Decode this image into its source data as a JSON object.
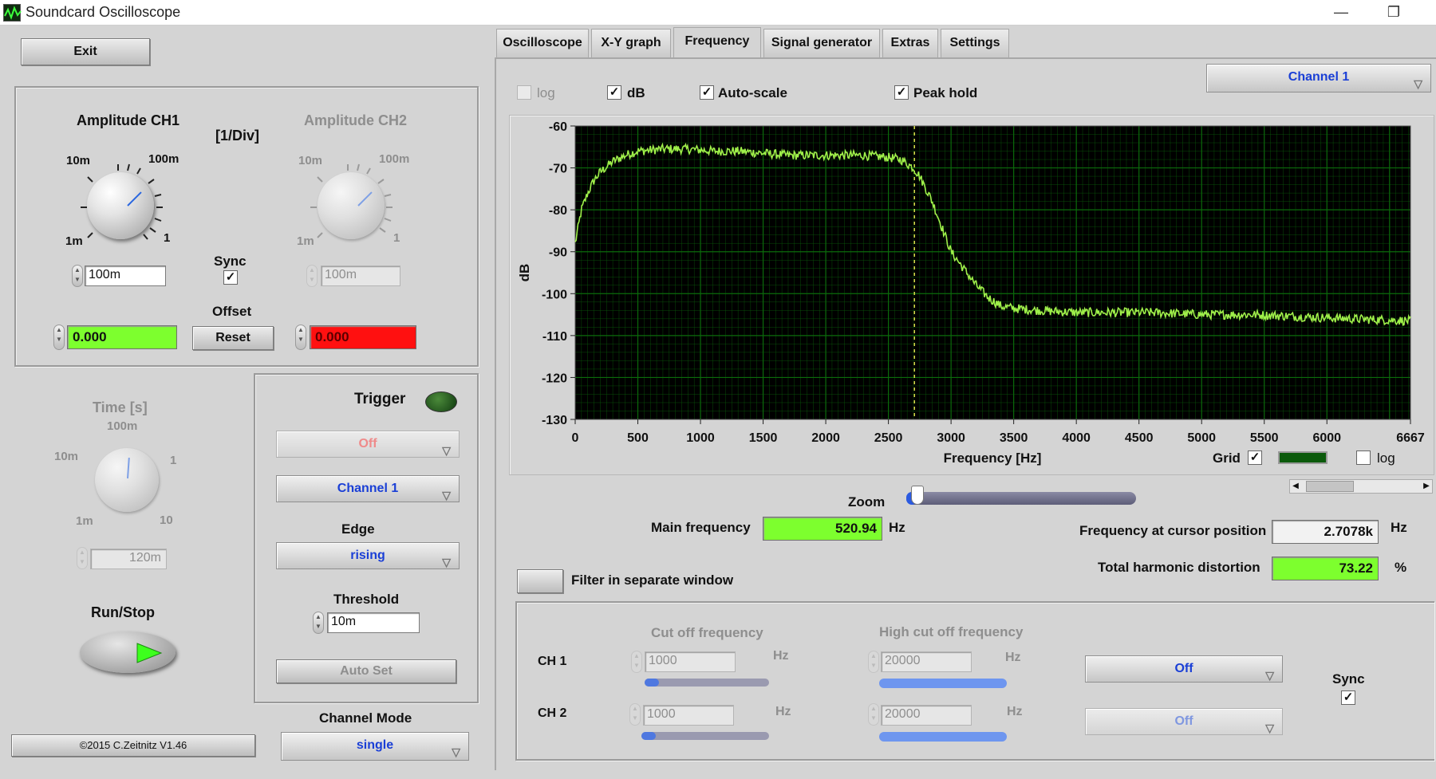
{
  "window": {
    "title": "Soundcard Oscilloscope",
    "minimize_glyph": "—",
    "restore_glyph": "❐"
  },
  "left": {
    "exit_label": "Exit",
    "amp_ch1": {
      "title": "Amplitude CH1",
      "min": "1m",
      "t10m": "10m",
      "t100m": "100m",
      "max": "1",
      "value": "100m"
    },
    "amp_unit": "[1/Div]",
    "amp_ch2": {
      "title": "Amplitude CH2",
      "min": "1m",
      "t10m": "10m",
      "t100m": "100m",
      "max": "1",
      "value": "100m"
    },
    "sync_label": "Sync",
    "offset_label": "Offset",
    "reset_label": "Reset",
    "offset_ch1": "0.000",
    "offset_ch2": "0.000",
    "time": {
      "title": "Time [s]",
      "t1m": "1m",
      "t10m": "10m",
      "t100m": "100m",
      "t1": "1",
      "t10": "10",
      "value": "120m"
    },
    "run_stop_label": "Run/Stop",
    "copyright": "©2015  C.Zeitnitz V1.46",
    "trigger": {
      "title": "Trigger",
      "mode": "Off",
      "channel": "Channel 1",
      "edge_label": "Edge",
      "edge": "rising",
      "threshold_label": "Threshold",
      "threshold": "10m",
      "auto_set_label": "Auto Set"
    },
    "channel_mode_label": "Channel Mode",
    "channel_mode": "single"
  },
  "tabs": [
    {
      "label": "Oscilloscope"
    },
    {
      "label": "X-Y graph"
    },
    {
      "label": "Frequency"
    },
    {
      "label": "Signal generator"
    },
    {
      "label": "Extras"
    },
    {
      "label": "Settings"
    }
  ],
  "frequency": {
    "channel_select": "Channel 1",
    "opt_log": "log",
    "opt_db": "dB",
    "opt_autoscale": "Auto-scale",
    "opt_peakhold": "Peak hold",
    "grid_label": "Grid",
    "xlog_label": "log",
    "zoom_label": "Zoom",
    "main_freq_label": "Main frequency",
    "main_freq_value": "520.94",
    "main_freq_unit": "Hz",
    "cursor_freq_label": "Frequency at cursor position",
    "cursor_freq_value": "2.7078k",
    "cursor_freq_unit": "Hz",
    "thd_label": "Total harmonic distortion",
    "thd_value": "73.22",
    "thd_unit": "%",
    "filter_window_label": "Filter in separate window",
    "filter": {
      "cutoff_label": "Cut off frequency",
      "high_cutoff_label": "High cut off frequency",
      "hz": "Hz",
      "ch1_label": "CH 1",
      "ch2_label": "CH 2",
      "ch1_cutoff": "1000",
      "ch1_high": "20000",
      "ch2_cutoff": "1000",
      "ch2_high": "20000",
      "ch1_mode": "Off",
      "ch2_mode": "Off",
      "sync_label": "Sync"
    }
  },
  "colors": {
    "plot_bg": "#000000",
    "grid": "#0b6b0b",
    "trace": "#9ff04a",
    "cursor": "#d8d84a",
    "green_field": "#7dff2e",
    "red_field": "#ff1010",
    "accent_blue": "#1a3fd6"
  },
  "chart_data": {
    "type": "line",
    "xlabel": "Frequency [Hz]",
    "ylabel": "dB",
    "xlim": [
      0,
      6667
    ],
    "ylim": [
      -130,
      -60
    ],
    "xticks": [
      "0",
      "500",
      "1000",
      "1500",
      "2000",
      "2500",
      "3000",
      "3500",
      "4000",
      "4500",
      "5000",
      "5500",
      "6000",
      "6667"
    ],
    "yticks": [
      "-60",
      "-70",
      "-80",
      "-90",
      "-100",
      "-110",
      "-120",
      "-130"
    ],
    "grid": true,
    "cursor_x": 2707.8,
    "x": [
      0,
      50,
      100,
      150,
      200,
      300,
      400,
      500,
      700,
      900,
      1100,
      1300,
      1500,
      1700,
      1900,
      2100,
      2300,
      2500,
      2600,
      2700,
      2750,
      2800,
      2850,
      2900,
      2950,
      3000,
      3100,
      3200,
      3300,
      3400,
      3500,
      3700,
      4000,
      4300,
      4600,
      5000,
      5400,
      5800,
      6200,
      6667
    ],
    "y": [
      -88,
      -80,
      -76,
      -73,
      -71,
      -68.5,
      -67,
      -66,
      -65.5,
      -65.5,
      -66,
      -66,
      -66.5,
      -67,
      -67,
      -67,
      -67,
      -67.5,
      -68,
      -70,
      -72,
      -75,
      -78,
      -82,
      -86,
      -90,
      -94,
      -98,
      -101,
      -103,
      -103.5,
      -104,
      -104.5,
      -104.5,
      -104.5,
      -105,
      -105,
      -105.5,
      -106,
      -106.5
    ]
  }
}
